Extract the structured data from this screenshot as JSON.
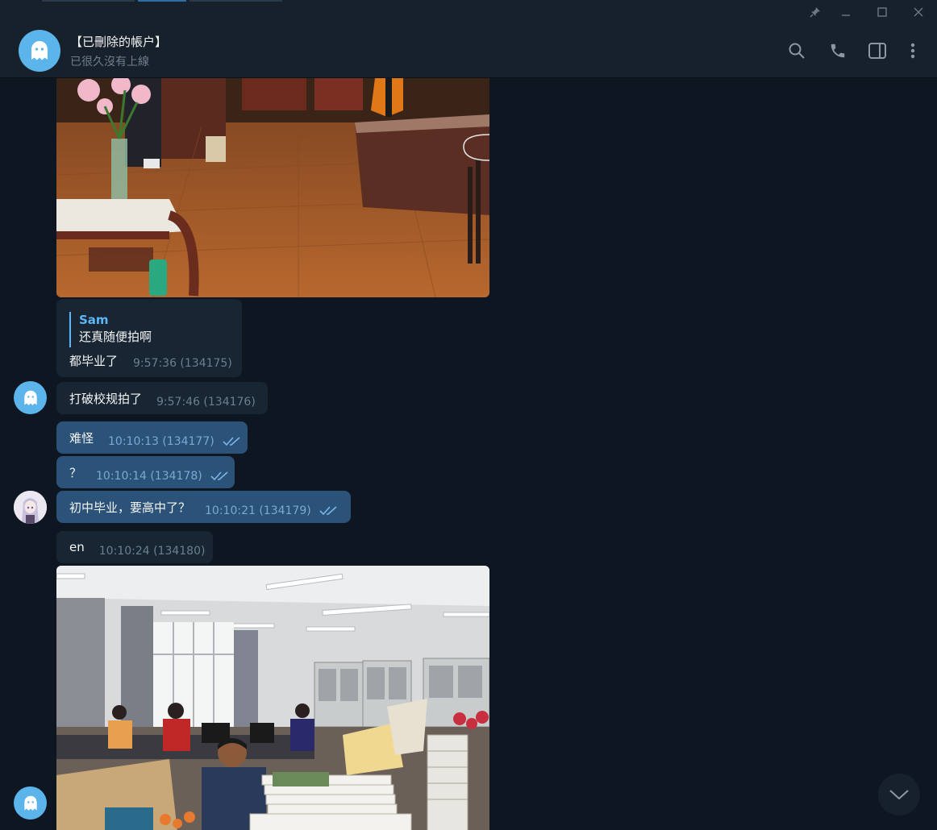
{
  "header": {
    "title": "【已刪除的帳户】",
    "status": "已很久沒有上線"
  },
  "colors": {
    "background": "#0e1621",
    "incoming_bubble": "#182533",
    "outgoing_bubble": "#2b5278",
    "accent": "#5eb5f7",
    "avatar_blue": "#5bb4ea"
  },
  "icons": {
    "pin": "pin-icon",
    "minimize": "minimize-icon",
    "maximize": "maximize-icon",
    "close": "close-icon",
    "search": "search-icon",
    "call": "phone-icon",
    "sidebar": "sidebar-toggle-icon",
    "more": "more-vertical-icon",
    "scroll": "chevron-down-icon"
  },
  "messages": {
    "reply": {
      "quote_name": "Sam",
      "quote_text": "还真随便拍啊",
      "text": "都毕业了",
      "time": "9:57:36 (134175)"
    },
    "m176": {
      "text": "打破校规拍了",
      "time": "9:57:46 (134176)"
    },
    "m177": {
      "text": "难怪",
      "time": "10:10:13 (134177)"
    },
    "m178": {
      "text": "？",
      "time": "10:10:14 (134178)"
    },
    "m179": {
      "text": "初中毕业，要高中了？",
      "time": "10:10:21 (134179)"
    },
    "m180": {
      "text": "en",
      "time": "10:10:24 (134180)"
    }
  }
}
